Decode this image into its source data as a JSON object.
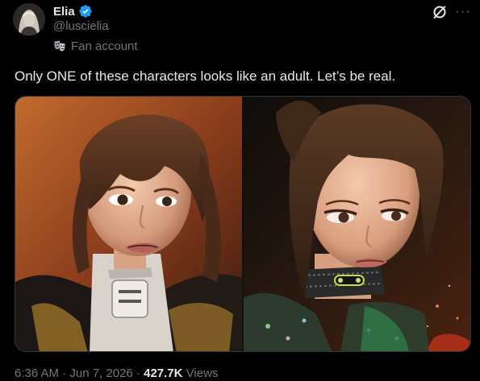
{
  "author": {
    "display_name": "Elia",
    "handle": "@luscielia",
    "label": "Fan account",
    "verified_color": "#1d9bf0"
  },
  "header_actions": {
    "grok_icon": "grok-icon",
    "more_label": "···"
  },
  "post": {
    "text": "Only ONE of these characters looks like an adult. Let’s be real."
  },
  "media": {
    "left_image": "left-character-image",
    "right_image": "right-character-image"
  },
  "meta": {
    "timestamp": "6:36 AM · Jun 7, 2026 ·",
    "views_count": "427.7K",
    "views_label": "Views"
  },
  "colors": {
    "background": "#000000",
    "text": "#e7e9ea",
    "secondary": "#71767b",
    "accent": "#1d9bf0"
  }
}
